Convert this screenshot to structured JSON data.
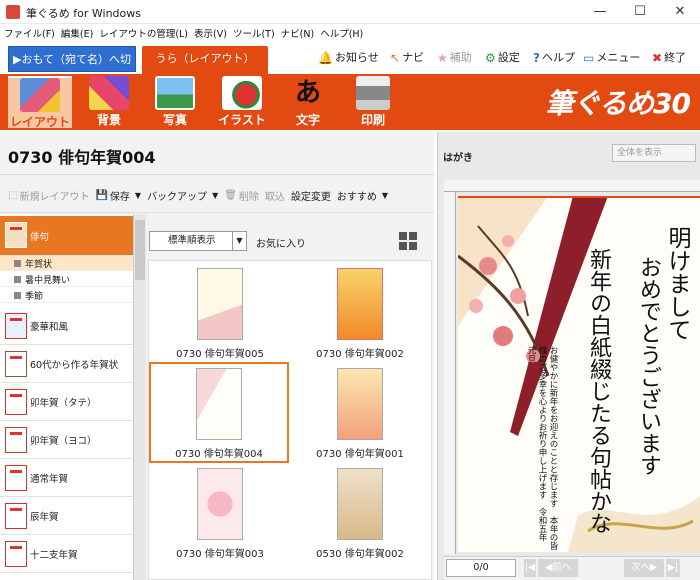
{
  "window": {
    "title": "筆ぐるめ for Windows",
    "controls": [
      "—",
      "☐",
      "✕"
    ]
  },
  "menubar": [
    "ファイル(F)",
    "編集(E)",
    "レイアウトの管理(L)",
    "表示(V)",
    "ツール(T)",
    "ナビ(N)",
    "ヘルプ(H)"
  ],
  "tabs": {
    "front": "▶おもて（宛て名）へ切替",
    "back": "うら（レイアウト）"
  },
  "toplinks": [
    {
      "icon": "bell-icon",
      "label": "お知らせ"
    },
    {
      "icon": "pointer-icon",
      "label": "ナビ"
    },
    {
      "icon": "star-icon",
      "label": "補助"
    },
    {
      "icon": "gear-icon",
      "label": "設定"
    },
    {
      "icon": "help-icon",
      "label": "ヘルプ"
    },
    {
      "icon": "window-icon",
      "label": "メニュー"
    },
    {
      "icon": "close-icon",
      "label": "終了"
    }
  ],
  "toolbar": [
    "レイアウト",
    "背景",
    "写真",
    "イラスト",
    "文字",
    "印刷"
  ],
  "brand": "筆ぐるめ30",
  "document": {
    "title": "0730 俳句年賀004"
  },
  "actions": {
    "new_layout": "新規レイアウト",
    "save": "保存",
    "backup": "バックアップ",
    "delete": "削除",
    "import": "取込",
    "change_settings": "設定変更",
    "recommend": "おすすめ"
  },
  "categories": {
    "selected": "俳句",
    "subcategories": [
      "年賀状",
      "暑中見舞い",
      "季節"
    ],
    "items": [
      "豪華和風",
      "60代から作る年賀状",
      "卯年賀（タテ）",
      "卯年賀（ヨコ）",
      "通常年賀",
      "辰年賀",
      "十二支年賀"
    ]
  },
  "sort": {
    "selected": "標準順表示",
    "favorites": "お気に入り"
  },
  "templates": [
    {
      "caption": "0730 俳句年賀005",
      "selected": false
    },
    {
      "caption": "0730 俳句年賀002",
      "selected": false
    },
    {
      "caption": "0730 俳句年賀004",
      "selected": true
    },
    {
      "caption": "0730 俳句年賀001",
      "selected": false
    },
    {
      "caption": "0730 俳句年賀003",
      "selected": false
    },
    {
      "caption": "0530 俳句年賀002",
      "selected": false
    }
  ],
  "preview": {
    "label": "はがき",
    "view_select": "全体を表示",
    "greeting": "明けまして",
    "greeting2": "おめでとうございます",
    "haiku": "新年の白紙綴じたる句帖かな",
    "message": "お健やかに新年をお迎えのことと存じます　本年の皆様のご多幸を心よりお祈り申し上げます　令和五年　元旦",
    "page": "0/0",
    "prev": "◀前へ",
    "next": "次へ▶"
  },
  "colors": {
    "accent": "#e24a12",
    "tab_front": "#2e6fd1",
    "selected_category": "#e87722"
  }
}
